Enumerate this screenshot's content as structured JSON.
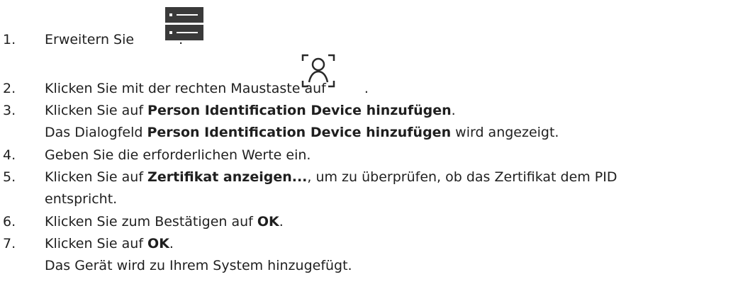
{
  "steps": [
    {
      "number": "1.",
      "text": "Erweitern Sie",
      "suffix": ".",
      "icon": "server-list-icon"
    },
    {
      "number": "2.",
      "text": "Klicken Sie mit der rechten Maustaste auf",
      "suffix": ".",
      "icon": "person-identification-icon"
    },
    {
      "number": "3.",
      "pre": "Klicken Sie auf ",
      "bold": "Person Identification Device hinzufügen",
      "post": ".",
      "result_pre": "Das Dialogfeld ",
      "result_bold": "Person Identification Device hinzufügen",
      "result_post": " wird angezeigt."
    },
    {
      "number": "4.",
      "text": "Geben Sie die erforderlichen Werte ein."
    },
    {
      "number": "5.",
      "pre": "Klicken Sie auf ",
      "bold": "Zertifikat anzeigen...",
      "post": ", um zu überprüfen, ob das Zertifikat dem PID",
      "continuation": "entspricht."
    },
    {
      "number": "6.",
      "pre": "Klicken Sie zum Bestätigen auf ",
      "bold": "OK",
      "post": "."
    },
    {
      "number": "7.",
      "pre": "Klicken Sie auf ",
      "bold": "OK",
      "post": ".",
      "result": "Das Gerät wird zu Ihrem System hinzugefügt."
    }
  ]
}
